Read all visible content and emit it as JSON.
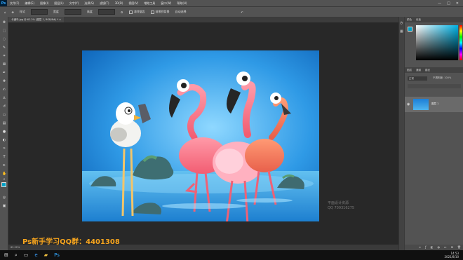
{
  "menubar": {
    "items": [
      "文件(F)",
      "编辑(E)",
      "图像(I)",
      "图层(L)",
      "文字(Y)",
      "选择(S)",
      "滤镜(T)",
      "3D(D)",
      "视图(V)",
      "增效工具",
      "窗口(W)",
      "帮助(H)"
    ],
    "logo": "Ps",
    "minimize": "—",
    "maximize": "□",
    "close": "✕"
  },
  "options": {
    "tool_label": "样式",
    "mode": "正常",
    "width_label": "宽度",
    "height_label": "高度",
    "antialias": "消除锯齿",
    "blend_label": "前景到背景",
    "auto_select": "自动选择"
  },
  "document": {
    "tab_title": "卡通鸟.jpg @ 62.2% (图层 1, RGB/8#) *  ×",
    "status": "62.22%"
  },
  "overlay": {
    "qq_note": "Ps新手学习QQ群：4401308",
    "watermark_line1": "平面设计资源",
    "watermark_line2": "QQ 709316275"
  },
  "panels": {
    "color_tabs": [
      "颜色",
      "色板"
    ],
    "layers_tabs": [
      "图层",
      "通道",
      "路径"
    ],
    "layer_name": "图层 1",
    "blend_mode": "正常",
    "opacity": "不透明度: 100%"
  },
  "colors": {
    "foreground": "#00a2c7",
    "background": "#111111"
  },
  "taskbar": {
    "start": "⊞",
    "time": "14:53",
    "date": "2021/8/10"
  }
}
